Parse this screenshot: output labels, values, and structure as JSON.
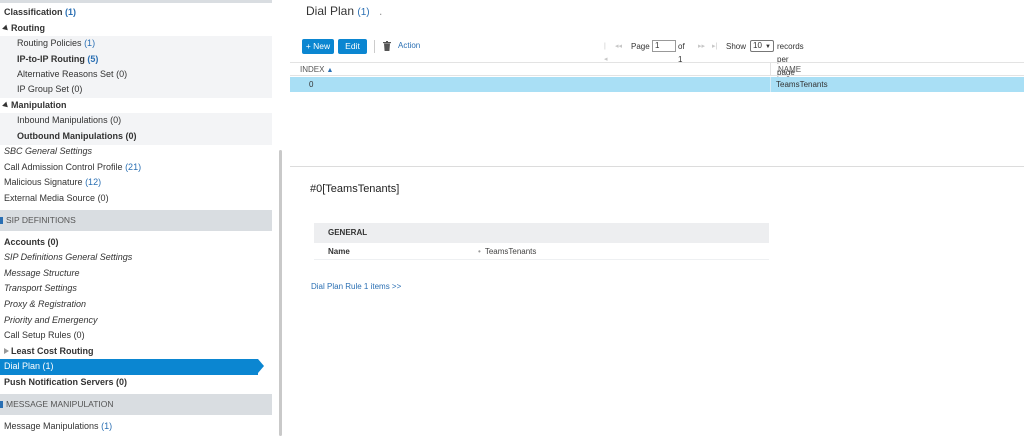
{
  "sidebar": {
    "items": [
      {
        "label": "Classification",
        "count": "(1)"
      },
      {
        "label": "Routing"
      },
      {
        "label": "Routing Policies",
        "count": "(1)"
      },
      {
        "label": "IP-to-IP Routing",
        "count": "(5)"
      },
      {
        "label": "Alternative Reasons Set",
        "count": "(0)"
      },
      {
        "label": "IP Group Set",
        "count": "(0)"
      },
      {
        "label": "Manipulation"
      },
      {
        "label": "Inbound Manipulations",
        "count": "(0)"
      },
      {
        "label": "Outbound Manipulations",
        "count": "(0)"
      },
      {
        "label": "SBC General Settings"
      },
      {
        "label": "Call Admission Control Profile",
        "count": "(21)"
      },
      {
        "label": "Malicious Signature",
        "count": "(12)"
      },
      {
        "label": "External Media Source",
        "count": "(0)"
      },
      {
        "label": "Accounts",
        "count": "(0)"
      },
      {
        "label": "SIP Definitions General Settings"
      },
      {
        "label": "Message Structure"
      },
      {
        "label": "Transport Settings"
      },
      {
        "label": "Proxy & Registration"
      },
      {
        "label": "Priority and Emergency"
      },
      {
        "label": "Call Setup Rules",
        "count": "(0)"
      },
      {
        "label": "Least Cost Routing"
      },
      {
        "label": "Dial Plan",
        "count": "(1)"
      },
      {
        "label": "Push Notification Servers",
        "count": "(0)"
      },
      {
        "label": "Message Manipulations",
        "count": "(1)"
      }
    ],
    "sections": {
      "sip_definitions": "SIP DEFINITIONS",
      "message_manipulation": "MESSAGE MANIPULATION"
    }
  },
  "main": {
    "title": "Dial Plan",
    "title_count": "(1)",
    "title_dot": ".",
    "toolbar": {
      "new_label": "+ New",
      "edit_label": "Edit",
      "action_label": "Action"
    },
    "pager": {
      "first": "|◂",
      "prev": "◂◂",
      "page_label": "Page",
      "page_value": "1",
      "of_label": "of 1",
      "next": "▸▸",
      "last": "▸|",
      "show_label": "Show",
      "page_size": "10",
      "records_label": "records per page"
    },
    "table": {
      "columns": [
        "INDEX",
        "NAME"
      ],
      "rows": [
        {
          "index": "0",
          "name": "TeamsTenants"
        }
      ]
    },
    "detail": {
      "title": "#0[TeamsTenants]",
      "group_label": "GENERAL",
      "fields": [
        {
          "key": "Name",
          "value": "TeamsTenants"
        }
      ],
      "link": "Dial Plan Rule 1 items >>"
    }
  },
  "colors": {
    "accent": "#0b86d1",
    "link": "#2a6fb3",
    "selected_row": "#a9dff5",
    "section_bg": "#d9dde1"
  }
}
